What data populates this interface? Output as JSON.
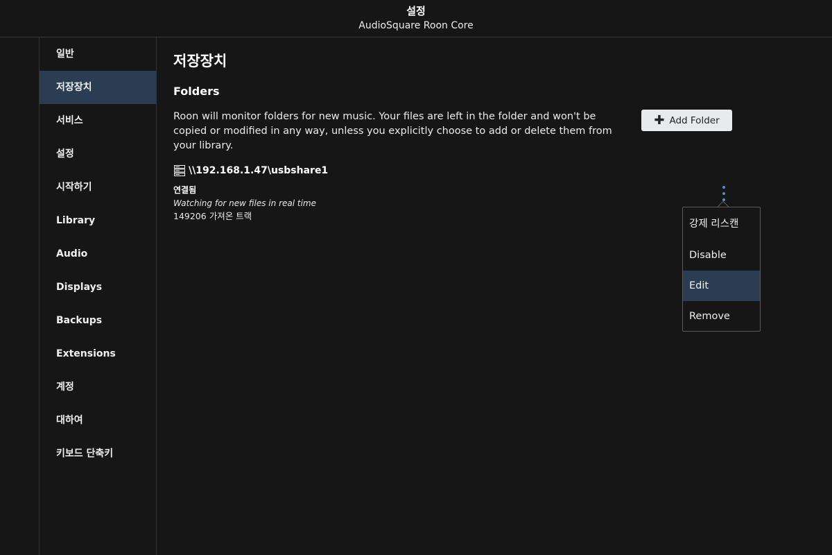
{
  "header": {
    "title": "설정",
    "subtitle": "AudioSquare Roon Core"
  },
  "sidebar": {
    "active_index": 1,
    "items": [
      {
        "label": "일반"
      },
      {
        "label": "저장장치"
      },
      {
        "label": "서비스"
      },
      {
        "label": "설정"
      },
      {
        "label": "시작하기"
      },
      {
        "label": "Library"
      },
      {
        "label": "Audio"
      },
      {
        "label": "Displays"
      },
      {
        "label": "Backups"
      },
      {
        "label": "Extensions"
      },
      {
        "label": "계정"
      },
      {
        "label": "대하여"
      },
      {
        "label": "키보드 단축키"
      }
    ]
  },
  "main": {
    "title": "저장장치",
    "section_title": "Folders",
    "description": "Roon will monitor folders for new music. Your files are left in the folder and won't be copied or modified in any way, unless you explicitly choose to add or delete them from your library.",
    "add_folder_label": "Add Folder",
    "add_folder_icon": "plus-icon",
    "folder": {
      "icon": "network-storage-icon",
      "path": "\\\\192.168.1.47\\usbshare1",
      "status": "연결됨",
      "watching": "Watching for new files in real time",
      "tracks": "149206 가져온 트랙"
    },
    "more_icon": "more-vertical-icon"
  },
  "context_menu": {
    "highlighted_index": 2,
    "items": [
      {
        "label": "강제 리스캔"
      },
      {
        "label": "Disable"
      },
      {
        "label": "Edit"
      },
      {
        "label": "Remove"
      }
    ]
  },
  "colors": {
    "background": "#161616",
    "active_highlight": "#2b3d52",
    "accent": "#4d8fd6",
    "button_bg": "#e8eaee"
  }
}
